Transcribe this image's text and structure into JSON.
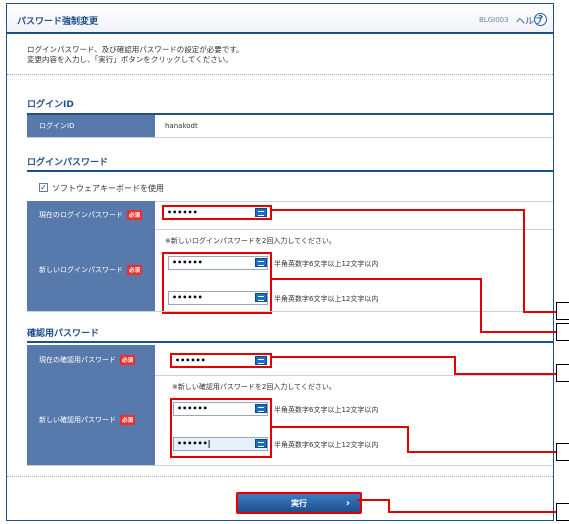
{
  "header": {
    "title": "パスワード強制変更",
    "screen_code": "BLGI003",
    "help_label": "ヘルプ",
    "help_icon": "?"
  },
  "intro": {
    "line1": "ログインパスワード、及び確認用パスワードの設定が必要です。",
    "line2": "変更内容を入力し、「実行」ボタンをクリックしてください。"
  },
  "login_id_section": {
    "title": "ログインID",
    "label": "ログインID",
    "value": "hanakodt"
  },
  "login_pw_section": {
    "title": "ログインパスワード",
    "software_keyboard_label": "ソフトウェアキーボードを使用",
    "software_keyboard_checked": true,
    "current_label": "現在のログインパスワード",
    "current_value": "••••••",
    "new_label": "新しいログインパスワード",
    "new_note": "※新しいログインパスワードを2回入力してください。",
    "new_value_1": "••••••",
    "new_value_2": "••••••",
    "length_hint": "半角英数字6文字以上12文字以内"
  },
  "confirm_pw_section": {
    "title": "確認用パスワード",
    "current_label": "現在の確認用パスワード",
    "current_value": "••••••",
    "new_label": "新しい確認用パスワード",
    "new_note": "※新しい確認用パスワードを2回入力してください。",
    "new_value_1": "••••••",
    "new_value_2": "••••••|",
    "length_hint": "半角英数字6文字以上12文字以内"
  },
  "required_badge": "必須",
  "execute_button": {
    "label": "実行",
    "arrow": "›"
  },
  "checkbox_mark": "✓",
  "colors": {
    "brand": "#1f4f8c",
    "label_cell": "#5779ac",
    "required": "#e8312e",
    "highlight": "#e40000"
  }
}
